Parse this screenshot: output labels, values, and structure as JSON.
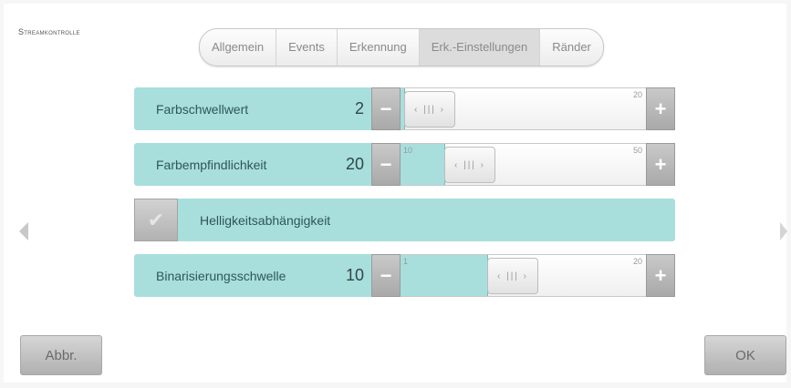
{
  "app": {
    "title": "Streamkontrolle"
  },
  "tabs": [
    {
      "label": "Allgemein",
      "active": false
    },
    {
      "label": "Events",
      "active": false
    },
    {
      "label": "Erkennung",
      "active": false
    },
    {
      "label": "Erk.-Einstellungen",
      "active": true
    },
    {
      "label": "Ränder",
      "active": false
    }
  ],
  "settings": {
    "farbschwellwert": {
      "label": "Farbschwellwert",
      "value": "2",
      "min": "1",
      "max": "20",
      "fraction": 0.0
    },
    "farbempfindlichkeit": {
      "label": "Farbempfindlichkeit",
      "value": "20",
      "min": "10",
      "max": "50",
      "fraction": 0.25
    },
    "helligkeit": {
      "label": "Helligkeitsabhängigkeit",
      "checked": false
    },
    "binarisierung": {
      "label": "Binarisierungsschwelle",
      "value": "10",
      "min": "1",
      "max": "20",
      "fraction": 0.47
    }
  },
  "stepper": {
    "minus": "−",
    "plus": "+",
    "thumb_grip": "‹ ||| ›"
  },
  "buttons": {
    "cancel": "Abbr.",
    "ok": "OK"
  },
  "colors": {
    "accent": "#a8dfdd",
    "button": "#b8b8b8"
  }
}
